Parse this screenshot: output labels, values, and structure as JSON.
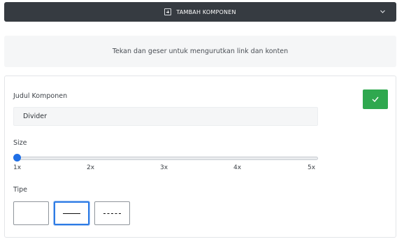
{
  "header": {
    "add_component_label": "TAMBAH KOMPONEN",
    "add_icon": "plus-square-icon",
    "toggle_icon": "chevron-down-icon"
  },
  "hint": {
    "text": "Tekan dan geser untuk mengurutkan link dan konten"
  },
  "component": {
    "title_label": "Judul Komponen",
    "title_value": "Divider",
    "confirm_icon": "check-icon",
    "confirm_color": "#2fa84f",
    "size_label": "Size",
    "size_ticks": [
      "1x",
      "2x",
      "3x",
      "4x",
      "5x"
    ],
    "size_value": "1x",
    "slider_color": "#1f6fe6",
    "type_label": "Tipe",
    "type_options": [
      "none",
      "solid",
      "dashed"
    ],
    "type_selected": "solid",
    "selected_border_color": "#2d7be5"
  }
}
